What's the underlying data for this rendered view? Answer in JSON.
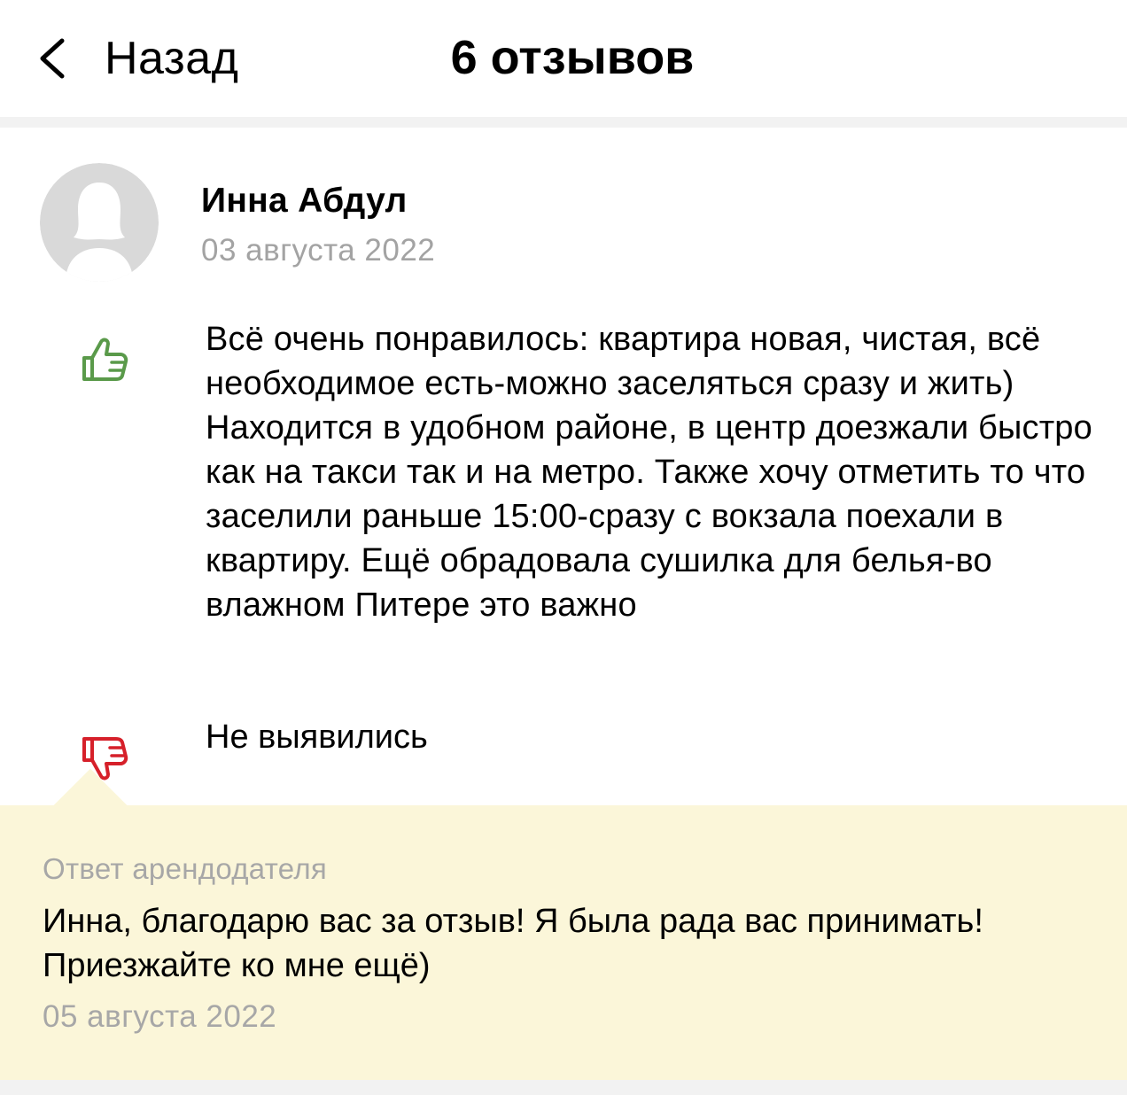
{
  "header": {
    "back_label": "Назад",
    "title": "6 отзывов"
  },
  "review": {
    "author": "Инна Абдул",
    "date": "03 августа 2022",
    "pros": "Всё очень понравилось: квартира новая, чистая, всё необходимое есть-можно заселяться сразу и жить) Находится в удобном районе, в центр доезжали быстро как на такси так и на метро. Также хочу отметить то что заселили раньше 15:00-сразу с вокзала поехали в квартиру. Ещё обрадовала сушилка для белья-во влажном Питере это важно",
    "cons": "Не выявились"
  },
  "reply": {
    "label": "Ответ арендодателя",
    "text": "Инна, благодарю вас за отзыв! Я была рада вас принимать! Приезжайте ко мне ещё)",
    "date": "05 августа 2022"
  },
  "icons": {
    "back": "chevron-left-icon",
    "pros": "thumbs-up-icon",
    "cons": "thumbs-down-icon",
    "avatar": "user-placeholder-icon"
  },
  "colors": {
    "pros_icon": "#5a9a4a",
    "cons_icon": "#d6202a",
    "reply_background": "#fbf6d9",
    "muted_text": "#a3a3a3"
  }
}
